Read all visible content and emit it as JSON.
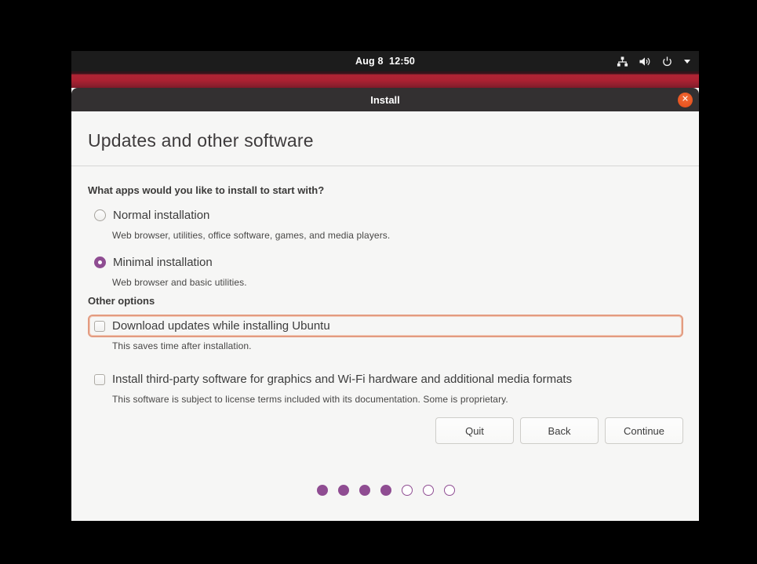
{
  "topbar": {
    "clock": "Aug 8  12:50",
    "icons": [
      "network-icon",
      "volume-icon",
      "power-icon",
      "chevron-down-icon"
    ]
  },
  "window": {
    "title": "Install",
    "close_label": "✕"
  },
  "page": {
    "title": "Updates and other software",
    "apps_question": "What apps would you like to install to start with?",
    "install_type_options": [
      {
        "label": "Normal installation",
        "description": "Web browser, utilities, office software, games, and media players.",
        "selected": false
      },
      {
        "label": "Minimal installation",
        "description": "Web browser and basic utilities.",
        "selected": true
      }
    ],
    "other_options_heading": "Other options",
    "other_options": [
      {
        "label": "Download updates while installing Ubuntu",
        "description": "This saves time after installation.",
        "checked": false,
        "focused": true
      },
      {
        "label": "Install third-party software for graphics and Wi-Fi hardware and additional media formats",
        "description": "This software is subject to license terms included with its documentation. Some is proprietary.",
        "checked": false,
        "focused": false
      }
    ],
    "buttons": {
      "quit": "Quit",
      "back": "Back",
      "continue": "Continue"
    },
    "progress": {
      "total": 7,
      "current": 4
    }
  },
  "colors": {
    "accent_orange": "#e95420",
    "focus_ring": "#e39b80",
    "selection_purple": "#8f4d92",
    "titlebar": "#333031",
    "topbar": "#1c1c1c",
    "wallpaper_red": "#ac2132",
    "content_bg": "#f6f6f5"
  }
}
